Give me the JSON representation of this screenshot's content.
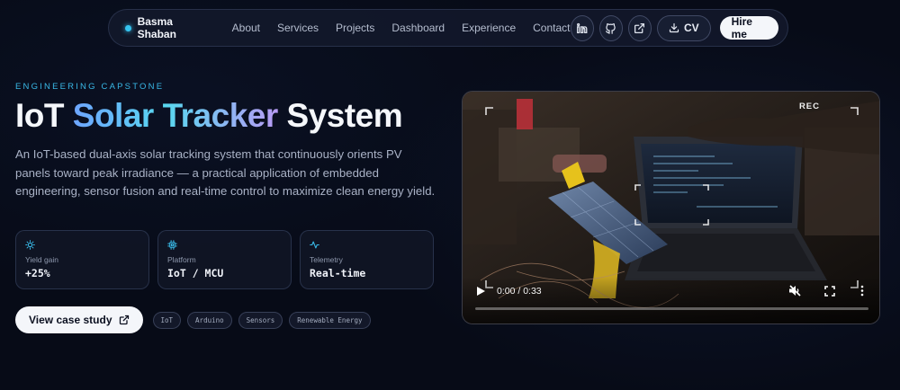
{
  "nav": {
    "brand": "Basma Shaban",
    "links": [
      "About",
      "Services",
      "Projects",
      "Dashboard",
      "Experience",
      "Contact"
    ],
    "icons": [
      "linkedin-icon",
      "github-icon",
      "external-link-icon"
    ],
    "cv_label": "CV",
    "hire_label": "Hire me"
  },
  "hero": {
    "eyebrow": "ENGINEERING CAPSTONE",
    "title_pre": "IoT ",
    "title_accent": "Solar Tracker",
    "title_post": " System",
    "description": "An IoT-based dual-axis solar tracking system that continuously orients PV panels toward peak irradiance — a practical application of embedded engineering, sensor fusion and real-time control to maximize clean energy yield.",
    "stats": [
      {
        "icon": "sun-icon",
        "label": "Yield gain",
        "value": "+25%"
      },
      {
        "icon": "chip-icon",
        "label": "Platform",
        "value": "IoT / MCU"
      },
      {
        "icon": "pulse-icon",
        "label": "Telemetry",
        "value": "Real-time"
      }
    ],
    "cta_label": "View case study",
    "tags": [
      "IoT",
      "Arduino",
      "Sensors",
      "Renewable Energy"
    ]
  },
  "video": {
    "rec_label": "REC",
    "time": "0:00 / 0:33",
    "progress": 0.0
  },
  "colors": {
    "background": "#070b17",
    "accent": "#39b8e6",
    "brand_dot": "#35c4f0",
    "button_light": "#f4f6fa"
  }
}
